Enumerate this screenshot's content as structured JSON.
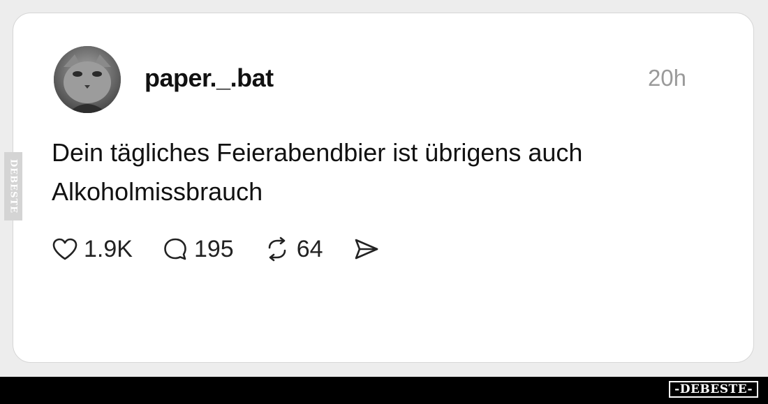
{
  "post": {
    "username": "paper._.bat",
    "time": "20h",
    "text": "Dein tägliches Feierabendbier ist übrigens auch Alkoholmissbrauch"
  },
  "actions": {
    "likes": "1.9K",
    "comments": "195",
    "reposts": "64"
  },
  "icons": {
    "like": "heart-icon",
    "comment": "speech-bubble-icon",
    "repost": "repost-arrows-icon",
    "share": "send-icon"
  },
  "watermark": {
    "side": "DEBESTE",
    "bottom": "-DEBESTE-"
  },
  "colors": {
    "card_background": "#ffffff",
    "page_background": "#ededed",
    "muted_text": "#9a9a9a",
    "bottom_bar": "#000000"
  }
}
